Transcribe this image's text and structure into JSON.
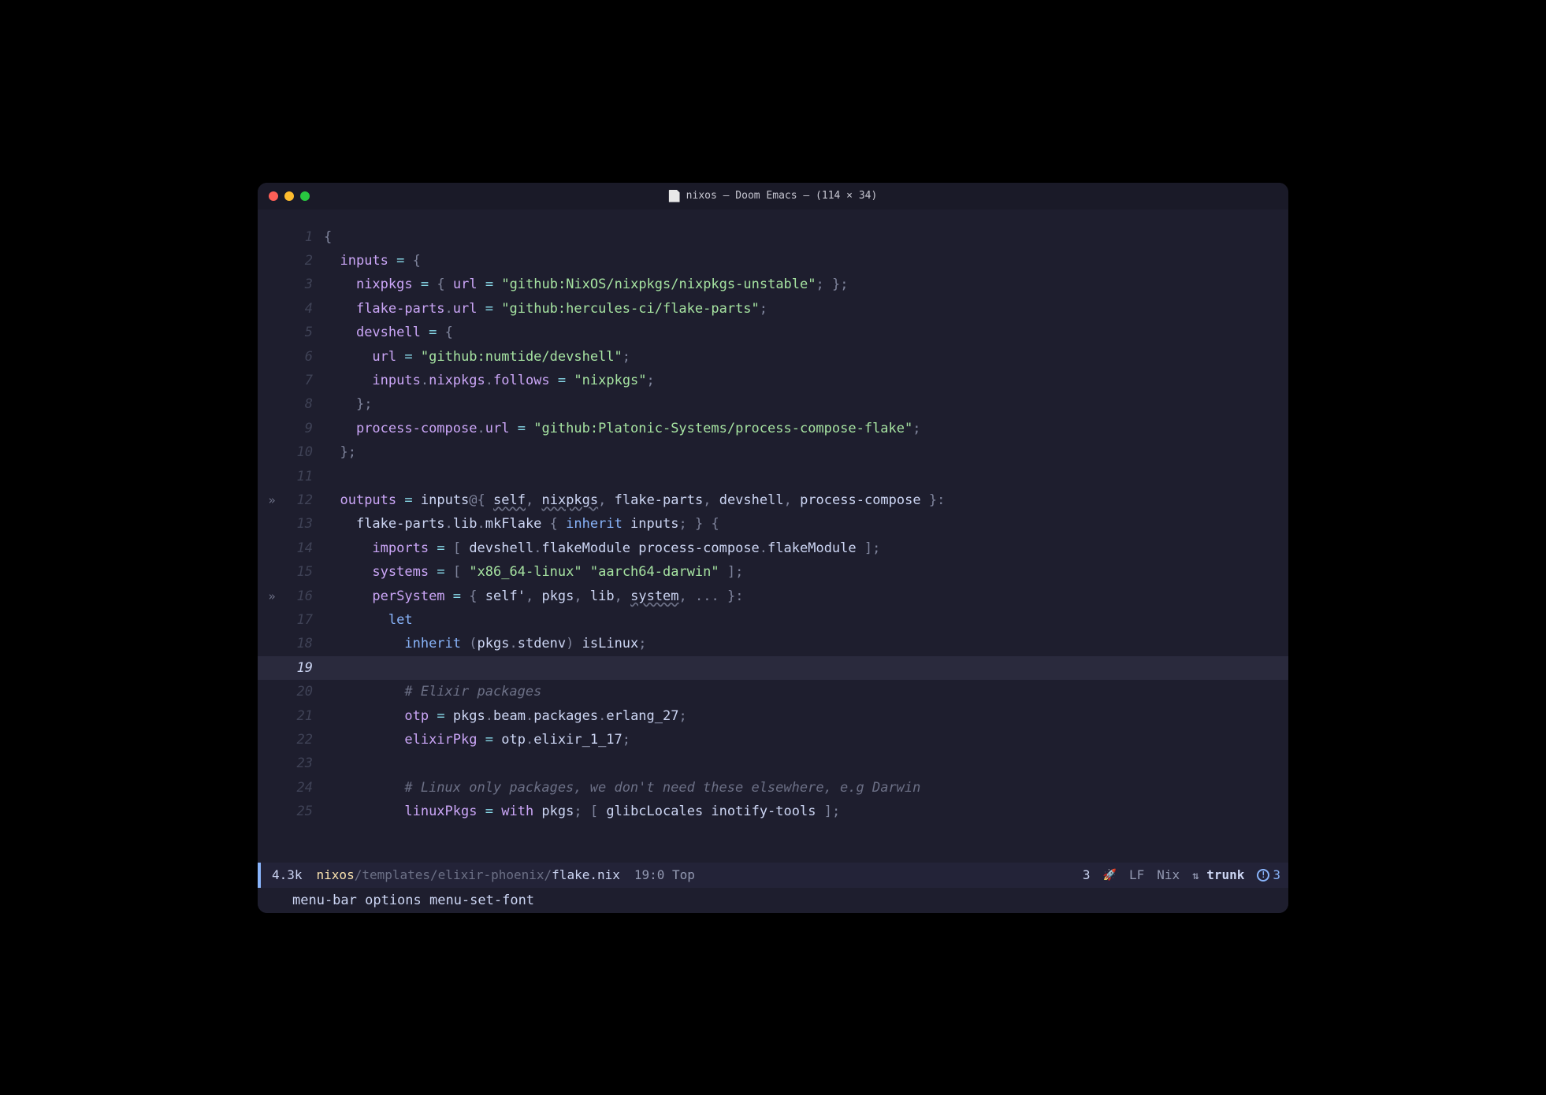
{
  "window": {
    "title": "nixos – Doom Emacs  —  (114 × 34)"
  },
  "code": {
    "lines": [
      {
        "n": 1,
        "tokens": [
          [
            "c-punct",
            "{"
          ]
        ]
      },
      {
        "n": 2,
        "tokens": [
          [
            "",
            "  "
          ],
          [
            "c-key",
            "inputs"
          ],
          [
            "c-ident",
            " "
          ],
          [
            "c-op",
            "="
          ],
          [
            "c-ident",
            " "
          ],
          [
            "c-punct",
            "{"
          ]
        ]
      },
      {
        "n": 3,
        "tokens": [
          [
            "",
            "    "
          ],
          [
            "c-key",
            "nixpkgs"
          ],
          [
            "c-ident",
            " "
          ],
          [
            "c-op",
            "="
          ],
          [
            "c-ident",
            " "
          ],
          [
            "c-punct",
            "{"
          ],
          [
            "c-ident",
            " "
          ],
          [
            "c-key",
            "url"
          ],
          [
            "c-ident",
            " "
          ],
          [
            "c-op",
            "="
          ],
          [
            "c-ident",
            " "
          ],
          [
            "c-str",
            "\"github:NixOS/nixpkgs/nixpkgs-unstable\""
          ],
          [
            "c-punct",
            ";"
          ],
          [
            "c-ident",
            " "
          ],
          [
            "c-punct",
            "};"
          ]
        ]
      },
      {
        "n": 4,
        "tokens": [
          [
            "",
            "    "
          ],
          [
            "c-key",
            "flake-parts"
          ],
          [
            "c-punct",
            "."
          ],
          [
            "c-key",
            "url"
          ],
          [
            "c-ident",
            " "
          ],
          [
            "c-op",
            "="
          ],
          [
            "c-ident",
            " "
          ],
          [
            "c-str",
            "\"github:hercules-ci/flake-parts\""
          ],
          [
            "c-punct",
            ";"
          ]
        ]
      },
      {
        "n": 5,
        "tokens": [
          [
            "",
            "    "
          ],
          [
            "c-key",
            "devshell"
          ],
          [
            "c-ident",
            " "
          ],
          [
            "c-op",
            "="
          ],
          [
            "c-ident",
            " "
          ],
          [
            "c-punct",
            "{"
          ]
        ]
      },
      {
        "n": 6,
        "tokens": [
          [
            "",
            "      "
          ],
          [
            "c-key",
            "url"
          ],
          [
            "c-ident",
            " "
          ],
          [
            "c-op",
            "="
          ],
          [
            "c-ident",
            " "
          ],
          [
            "c-str",
            "\"github:numtide/devshell\""
          ],
          [
            "c-punct",
            ";"
          ]
        ]
      },
      {
        "n": 7,
        "tokens": [
          [
            "",
            "      "
          ],
          [
            "c-key",
            "inputs"
          ],
          [
            "c-punct",
            "."
          ],
          [
            "c-key",
            "nixpkgs"
          ],
          [
            "c-punct",
            "."
          ],
          [
            "c-key",
            "follows"
          ],
          [
            "c-ident",
            " "
          ],
          [
            "c-op",
            "="
          ],
          [
            "c-ident",
            " "
          ],
          [
            "c-str",
            "\"nixpkgs\""
          ],
          [
            "c-punct",
            ";"
          ]
        ]
      },
      {
        "n": 8,
        "tokens": [
          [
            "",
            "    "
          ],
          [
            "c-punct",
            "};"
          ]
        ]
      },
      {
        "n": 9,
        "tokens": [
          [
            "",
            "    "
          ],
          [
            "c-key",
            "process-compose"
          ],
          [
            "c-punct",
            "."
          ],
          [
            "c-key",
            "url"
          ],
          [
            "c-ident",
            " "
          ],
          [
            "c-op",
            "="
          ],
          [
            "c-ident",
            " "
          ],
          [
            "c-str",
            "\"github:Platonic-Systems/process-compose-flake\""
          ],
          [
            "c-punct",
            ";"
          ]
        ]
      },
      {
        "n": 10,
        "tokens": [
          [
            "",
            "  "
          ],
          [
            "c-punct",
            "};"
          ]
        ]
      },
      {
        "n": 11,
        "tokens": []
      },
      {
        "n": 12,
        "fringe": "»",
        "tokens": [
          [
            "",
            "  "
          ],
          [
            "c-key",
            "outputs"
          ],
          [
            "c-ident",
            " "
          ],
          [
            "c-op",
            "="
          ],
          [
            "c-ident",
            " inputs"
          ],
          [
            "c-punct",
            "@{"
          ],
          [
            "c-ident",
            " "
          ],
          [
            "c-param-unused",
            "self"
          ],
          [
            "c-punct",
            ","
          ],
          [
            "c-ident",
            " "
          ],
          [
            "c-param-unused",
            "nixpkgs"
          ],
          [
            "c-punct",
            ","
          ],
          [
            "c-ident",
            " flake-parts"
          ],
          [
            "c-punct",
            ","
          ],
          [
            "c-ident",
            " devshell"
          ],
          [
            "c-punct",
            ","
          ],
          [
            "c-ident",
            " process-compose "
          ],
          [
            "c-punct",
            "}:"
          ]
        ]
      },
      {
        "n": 13,
        "tokens": [
          [
            "",
            "    "
          ],
          [
            "c-ident",
            "flake-parts"
          ],
          [
            "c-punct",
            "."
          ],
          [
            "c-ident",
            "lib"
          ],
          [
            "c-punct",
            "."
          ],
          [
            "c-ident",
            "mkFlake "
          ],
          [
            "c-punct",
            "{"
          ],
          [
            "c-ident",
            " "
          ],
          [
            "c-kw",
            "inherit"
          ],
          [
            "c-ident",
            " inputs"
          ],
          [
            "c-punct",
            ";"
          ],
          [
            "c-ident",
            " "
          ],
          [
            "c-punct",
            "}"
          ],
          [
            "c-ident",
            " "
          ],
          [
            "c-punct",
            "{"
          ]
        ]
      },
      {
        "n": 14,
        "tokens": [
          [
            "",
            "      "
          ],
          [
            "c-key",
            "imports"
          ],
          [
            "c-ident",
            " "
          ],
          [
            "c-op",
            "="
          ],
          [
            "c-ident",
            " "
          ],
          [
            "c-punct",
            "["
          ],
          [
            "c-ident",
            " devshell"
          ],
          [
            "c-punct",
            "."
          ],
          [
            "c-ident",
            "flakeModule process-compose"
          ],
          [
            "c-punct",
            "."
          ],
          [
            "c-ident",
            "flakeModule "
          ],
          [
            "c-punct",
            "];"
          ]
        ]
      },
      {
        "n": 15,
        "tokens": [
          [
            "",
            "      "
          ],
          [
            "c-key",
            "systems"
          ],
          [
            "c-ident",
            " "
          ],
          [
            "c-op",
            "="
          ],
          [
            "c-ident",
            " "
          ],
          [
            "c-punct",
            "["
          ],
          [
            "c-ident",
            " "
          ],
          [
            "c-str",
            "\"x86_64-linux\""
          ],
          [
            "c-ident",
            " "
          ],
          [
            "c-str",
            "\"aarch64-darwin\""
          ],
          [
            "c-ident",
            " "
          ],
          [
            "c-punct",
            "];"
          ]
        ]
      },
      {
        "n": 16,
        "fringe": "»",
        "tokens": [
          [
            "",
            "      "
          ],
          [
            "c-key",
            "perSystem"
          ],
          [
            "c-ident",
            " "
          ],
          [
            "c-op",
            "="
          ],
          [
            "c-ident",
            " "
          ],
          [
            "c-punct",
            "{"
          ],
          [
            "c-ident",
            " self'"
          ],
          [
            "c-punct",
            ","
          ],
          [
            "c-ident",
            " pkgs"
          ],
          [
            "c-punct",
            ","
          ],
          [
            "c-ident",
            " lib"
          ],
          [
            "c-punct",
            ","
          ],
          [
            "c-ident",
            " "
          ],
          [
            "c-param-unused",
            "system"
          ],
          [
            "c-punct",
            ","
          ],
          [
            "c-ident",
            " "
          ],
          [
            "c-punct",
            "..."
          ],
          [
            "c-ident",
            " "
          ],
          [
            "c-punct",
            "}:"
          ]
        ]
      },
      {
        "n": 17,
        "tokens": [
          [
            "",
            "        "
          ],
          [
            "c-kw",
            "let"
          ]
        ]
      },
      {
        "n": 18,
        "tokens": [
          [
            "",
            "          "
          ],
          [
            "c-kw",
            "inherit"
          ],
          [
            "c-ident",
            " "
          ],
          [
            "c-punct",
            "("
          ],
          [
            "c-ident",
            "pkgs"
          ],
          [
            "c-punct",
            "."
          ],
          [
            "c-ident",
            "stdenv"
          ],
          [
            "c-punct",
            ")"
          ],
          [
            "c-ident",
            " isLinux"
          ],
          [
            "c-punct",
            ";"
          ]
        ]
      },
      {
        "n": 19,
        "current": true,
        "tokens": []
      },
      {
        "n": 20,
        "tokens": [
          [
            "",
            "          "
          ],
          [
            "c-comment",
            "# Elixir packages"
          ]
        ]
      },
      {
        "n": 21,
        "tokens": [
          [
            "",
            "          "
          ],
          [
            "c-key",
            "otp"
          ],
          [
            "c-ident",
            " "
          ],
          [
            "c-op",
            "="
          ],
          [
            "c-ident",
            " pkgs"
          ],
          [
            "c-punct",
            "."
          ],
          [
            "c-ident",
            "beam"
          ],
          [
            "c-punct",
            "."
          ],
          [
            "c-ident",
            "packages"
          ],
          [
            "c-punct",
            "."
          ],
          [
            "c-ident",
            "erlang_27"
          ],
          [
            "c-punct",
            ";"
          ]
        ]
      },
      {
        "n": 22,
        "tokens": [
          [
            "",
            "          "
          ],
          [
            "c-key",
            "elixirPkg"
          ],
          [
            "c-ident",
            " "
          ],
          [
            "c-op",
            "="
          ],
          [
            "c-ident",
            " otp"
          ],
          [
            "c-punct",
            "."
          ],
          [
            "c-ident",
            "elixir_1_17"
          ],
          [
            "c-punct",
            ";"
          ]
        ]
      },
      {
        "n": 23,
        "tokens": []
      },
      {
        "n": 24,
        "tokens": [
          [
            "",
            "          "
          ],
          [
            "c-comment",
            "# Linux only packages, we don't need these elsewhere, e.g Darwin"
          ]
        ]
      },
      {
        "n": 25,
        "tokens": [
          [
            "",
            "          "
          ],
          [
            "c-key",
            "linuxPkgs"
          ],
          [
            "c-ident",
            " "
          ],
          [
            "c-op",
            "="
          ],
          [
            "c-ident",
            " "
          ],
          [
            "c-with",
            "with"
          ],
          [
            "c-ident",
            " pkgs"
          ],
          [
            "c-punct",
            ";"
          ],
          [
            "c-ident",
            " "
          ],
          [
            "c-punct",
            "["
          ],
          [
            "c-ident",
            " glibcLocales inotify-tools "
          ],
          [
            "c-punct",
            "];"
          ]
        ]
      }
    ]
  },
  "modeline": {
    "filesize": "4.3k",
    "path_project": "nixos",
    "path_sep1": "/",
    "path_dim": "templates/elixir-phoenix/",
    "path_file": "flake.nix",
    "position": "19:0 Top",
    "warn_count": "3",
    "encoding": "LF",
    "mode": "Nix",
    "branch": "trunk",
    "diag_count": "3"
  },
  "minibuffer": {
    "text": "menu-bar options menu-set-font"
  }
}
